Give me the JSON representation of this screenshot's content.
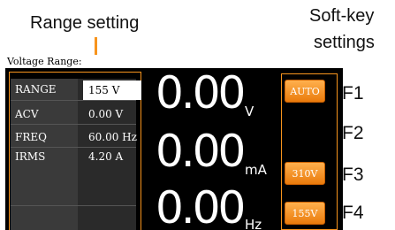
{
  "callouts": {
    "range_setting": "Range setting",
    "softkey_line1": "Soft-key",
    "softkey_line2": "settings"
  },
  "screen": {
    "title": "Voltage Range:",
    "settings": [
      {
        "label": "RANGE",
        "value": "155 V",
        "selected": true
      },
      {
        "label": "ACV",
        "value": "0.00 V",
        "selected": false
      },
      {
        "label": "FREQ",
        "value": "60.00 Hz",
        "selected": false
      },
      {
        "label": "IRMS",
        "value": "4.20 A",
        "selected": false
      }
    ],
    "measurements": [
      {
        "value": "0.00",
        "unit": "V"
      },
      {
        "value": "0.00",
        "unit": "mA"
      },
      {
        "value": "0.00",
        "unit": "Hz"
      }
    ],
    "softkeys": {
      "f1": "AUTO",
      "f3": "310V",
      "f4": "155V"
    }
  },
  "function_keys": [
    "F1",
    "F2",
    "F3",
    "F4"
  ],
  "colors": {
    "accent": "#f7941d",
    "screen_bg": "#000000"
  }
}
